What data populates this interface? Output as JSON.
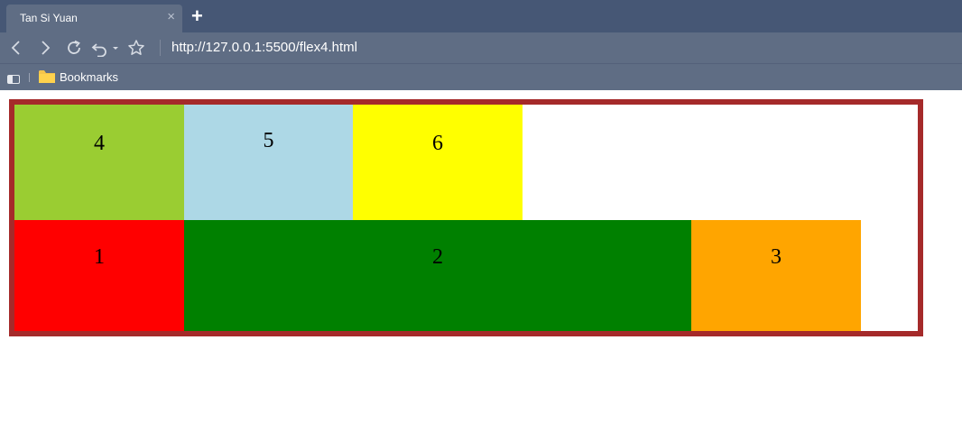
{
  "browser": {
    "tab_title": "Tan Si Yuan",
    "tab_close": "×",
    "new_tab": "+",
    "url": "http://127.0.0.1:5500/flex4.html",
    "bookmarks_label": "Bookmarks"
  },
  "page": {
    "container_border_color": "#a52a2a",
    "rows": [
      {
        "items": [
          {
            "label": "4",
            "color": "#9acd32"
          },
          {
            "label": "5",
            "color": "#add8e6"
          },
          {
            "label": "6",
            "color": "#ffff00"
          }
        ]
      },
      {
        "items": [
          {
            "label": "1",
            "color": "#ff0000"
          },
          {
            "label": "2",
            "color": "#008000"
          },
          {
            "label": "3",
            "color": "#ffa500"
          }
        ]
      }
    ]
  }
}
